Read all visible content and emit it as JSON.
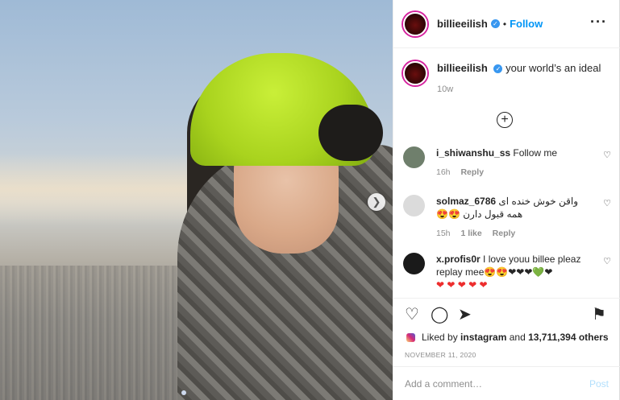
{
  "post": {
    "author": {
      "username": "billieeilish",
      "verified": true,
      "follow_label": "Follow",
      "bullet": "•"
    },
    "more_icon": "more-horizontal-icon",
    "caption": {
      "text": "your world’s an ideal",
      "time": "10w"
    },
    "load_more_icon": "plus-circle-icon",
    "comments": [
      {
        "username": "i_shiwanshu_ss",
        "text": "Follow me",
        "time": "16h",
        "likes": "",
        "reply_label": "Reply",
        "avatar_color": "#6f7f6c"
      },
      {
        "username": "solmaz_6786",
        "text": "واقن خوش خنده ای همه قبول دارن 😍😍",
        "time": "15h",
        "likes": "1 like",
        "reply_label": "Reply",
        "avatar_color": "#dbdbdb"
      },
      {
        "username": "x.profis0r",
        "text": "I love youu billee pleaz replay mee😍😍❤❤❤💚❤",
        "hearts": "❤ ❤ ❤ ❤ ❤",
        "time": "",
        "avatar_color": "#1a1a1a"
      }
    ],
    "likes": {
      "prefix": "Liked by",
      "user": "instagram",
      "and": "and",
      "count": "13,711,394 others"
    },
    "date": "NOVEMBER 11, 2020",
    "comment_input": {
      "placeholder": "Add a comment…",
      "value": "",
      "post_label": "Post"
    },
    "colors": {
      "link": "#0095f6",
      "verified": "#3897f0",
      "muted": "#8e8e8e",
      "post_disabled": "#b2dffc"
    }
  }
}
